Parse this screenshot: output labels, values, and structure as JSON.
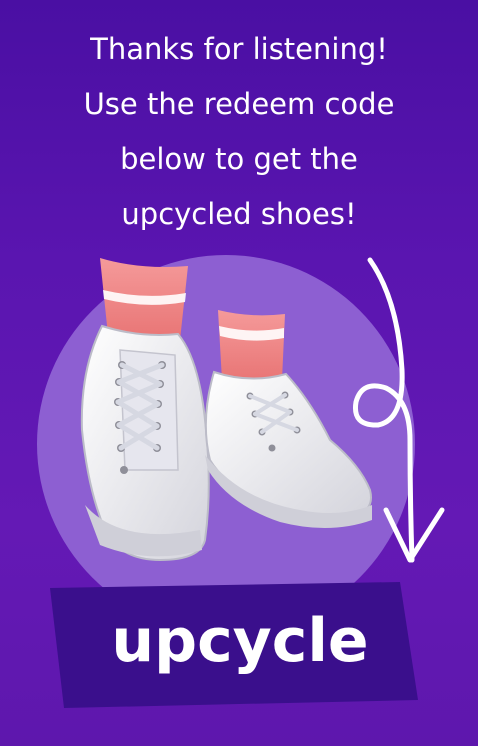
{
  "message": {
    "lines": [
      "Thanks for listening!",
      "Use the redeem code",
      "below to get the",
      "upcycled shoes!"
    ]
  },
  "redeem": {
    "code": "upcycle"
  },
  "colors": {
    "background": "#5410ab",
    "circle": "#8d5fd2",
    "banner": "#3a0f8c",
    "sock": "#f28a8a",
    "shoe": "#eeeef2",
    "text": "#ffffff"
  },
  "icons": {
    "arrow": "curly-arrow-down-icon",
    "product": "sneakers-icon"
  }
}
